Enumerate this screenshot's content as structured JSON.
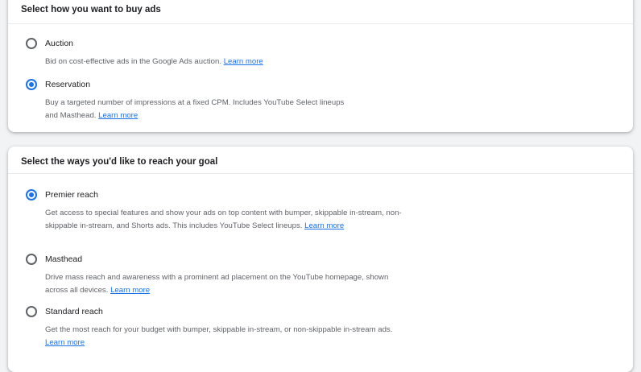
{
  "buy_section": {
    "title": "Select how you want to buy ads",
    "options": [
      {
        "label": "Auction",
        "selected": false,
        "description": "Bid on cost-effective ads in the Google Ads auction.",
        "link": "Learn more"
      },
      {
        "label": "Reservation",
        "selected": true,
        "description": "Buy a targeted number of impressions at a fixed CPM. Includes YouTube Select lineups and Masthead.",
        "link": "Learn more"
      }
    ]
  },
  "reach_section": {
    "title": "Select the ways you'd like to reach your goal",
    "options": [
      {
        "label": "Premier reach",
        "selected": true,
        "description": "Get access to special features and show your ads on top content with bumper, skippable in-stream, non-skippable in-stream, and Shorts ads. This includes YouTube Select lineups.",
        "link": "Learn more"
      },
      {
        "label": "Masthead",
        "selected": false,
        "description": "Drive mass reach and awareness with a prominent ad placement on the YouTube homepage, shown across all devices.",
        "link": "Learn more"
      },
      {
        "label": "Standard reach",
        "selected": false,
        "description": "Get the most reach for your budget with bumper, skippable in-stream, or non-skippable in-stream ads.",
        "link": "Learn more"
      }
    ]
  },
  "colors": {
    "accent": "#1a73e8",
    "radio_unselected": "#5f6368",
    "text_secondary": "#5f6368"
  }
}
